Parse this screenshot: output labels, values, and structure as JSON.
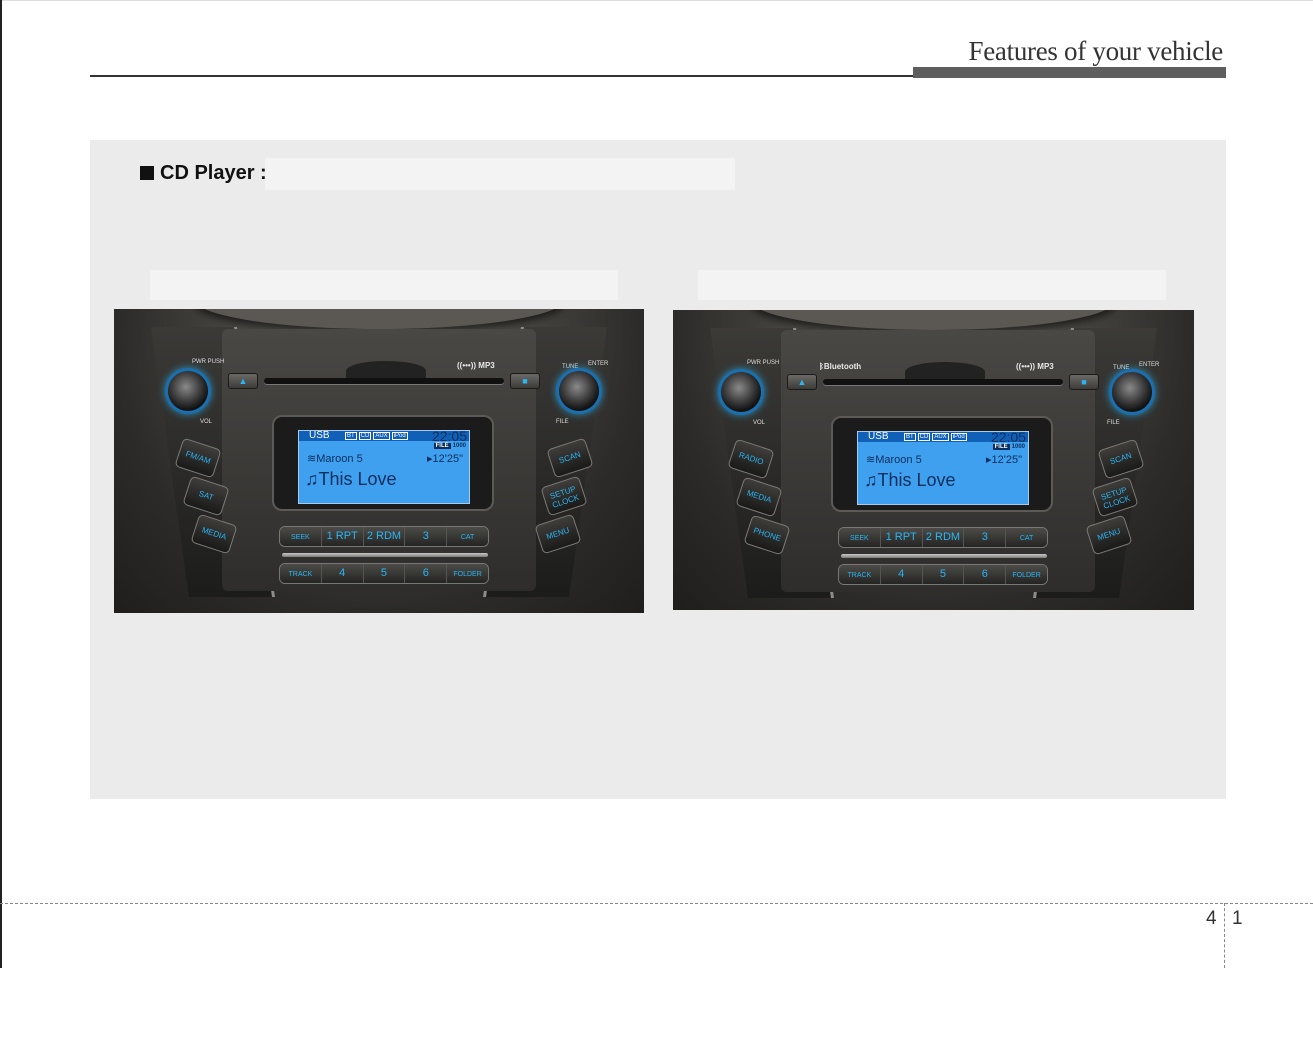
{
  "header": {
    "title": "Features of your vehicle"
  },
  "section": {
    "title": "CD Player :"
  },
  "panels": [
    {
      "labels": {
        "pwr": "PWR PUSH",
        "vol": "VOL",
        "tune": "TUNE",
        "enter": "ENTER",
        "file": "FILE",
        "brand": "((•••)) MP3"
      },
      "screen": {
        "source": "USB",
        "icons": [
          "BT",
          "CD",
          "AUX",
          "iPod"
        ],
        "time": "22:05",
        "file_tag": "FILE",
        "file_num": "1000",
        "artist": "Maroon 5",
        "duration": "12'25\"",
        "song": "This Love"
      },
      "left_buttons": [
        "FM/AM",
        "SAT",
        "MEDIA"
      ],
      "right_buttons": [
        "SCAN",
        "SETUP CLOCK",
        "MENU"
      ],
      "row1": [
        "SEEK",
        "1 RPT",
        "2 RDM",
        "3",
        "CAT"
      ],
      "row2": [
        "TRACK",
        "4",
        "5",
        "6",
        "FOLDER"
      ]
    },
    {
      "labels": {
        "pwr": "PWR PUSH",
        "vol": "VOL",
        "tune": "TUNE",
        "enter": "ENTER",
        "file": "FILE",
        "brand": "((•••)) MP3",
        "bluetooth": "Bluetooth"
      },
      "screen": {
        "source": "USB",
        "icons": [
          "BT",
          "CD",
          "AUX",
          "iPod"
        ],
        "time": "22:05",
        "file_tag": "FILE",
        "file_num": "1000",
        "artist": "Maroon 5",
        "duration": "12'25\"",
        "song": "This Love"
      },
      "left_buttons": [
        "RADIO",
        "MEDIA",
        "PHONE"
      ],
      "right_buttons": [
        "SCAN",
        "SETUP CLOCK",
        "MENU"
      ],
      "row1": [
        "SEEK",
        "1 RPT",
        "2 RDM",
        "3",
        "CAT"
      ],
      "row2": [
        "TRACK",
        "4",
        "5",
        "6",
        "FOLDER"
      ]
    }
  ],
  "footer": {
    "chapter": "4",
    "page": "1"
  }
}
